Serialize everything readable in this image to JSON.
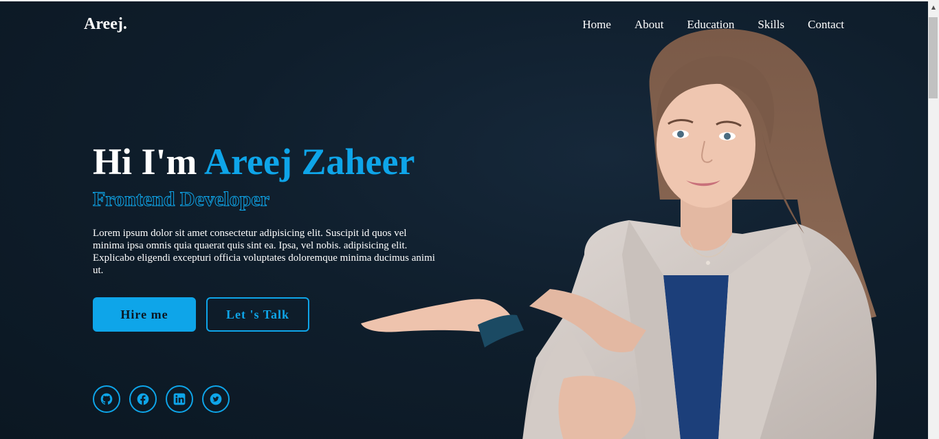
{
  "brand": "Areej.",
  "nav": {
    "items": [
      "Home",
      "About",
      "Education",
      "Skills",
      "Contact"
    ]
  },
  "hero": {
    "greeting": "Hi I'm",
    "name": "Areej Zaheer",
    "role": "Frontend Developer",
    "description": "Lorem ipsum dolor sit amet consectetur adipisicing elit. Suscipit id quos vel minima ipsa omnis quia quaerat quis sint ea. Ipsa, vel nobis. adipisicing elit. Explicabo eligendi excepturi officia voluptates doloremque minima ducimus animi ut.",
    "buttons": {
      "hire": "Hire me",
      "talk": "Let 's Talk"
    }
  },
  "social": [
    "github-icon",
    "facebook-icon",
    "linkedin-icon",
    "twitter-icon"
  ],
  "colors": {
    "accent": "#0ea5e9",
    "background": "#0f1e2c",
    "text": "#ffffff"
  }
}
